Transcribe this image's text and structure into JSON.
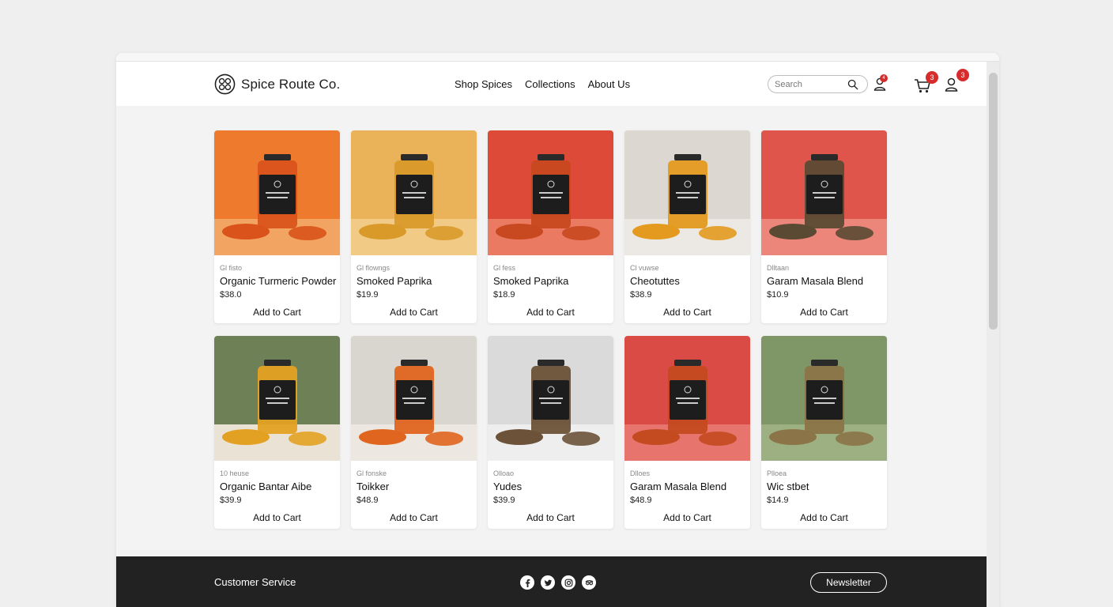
{
  "brand": {
    "name": "Spice Route Co."
  },
  "nav": [
    {
      "label": "Shop Spices"
    },
    {
      "label": "Collections"
    },
    {
      "label": "About Us"
    }
  ],
  "search": {
    "placeholder": "Search"
  },
  "header_icons": {
    "account_small_badge": "4",
    "cart_badge": "3",
    "user_badge": "3"
  },
  "colors": {
    "accent": "#d82b2b",
    "footer_bg": "#222222",
    "card_bg": "#ffffff"
  },
  "products": [
    {
      "category": "Gl fisto",
      "name": "Organic Turmeric Powder",
      "price": "$38.0",
      "button": "Add to Cart",
      "bg": "#ee7a2e",
      "bg2": "#f2a562",
      "powder": "#d9531b"
    },
    {
      "category": "Gl flowngs",
      "name": "Smoked Paprika",
      "price": "$19.9",
      "button": "Add to Cart",
      "bg": "#eab35a",
      "bg2": "#f1ca86",
      "powder": "#d99a2a"
    },
    {
      "category": "Gl fess",
      "name": "Smoked Paprika",
      "price": "$18.9",
      "button": "Add to Cart",
      "bg": "#de4a38",
      "bg2": "#ea7a61",
      "powder": "#c8481f"
    },
    {
      "category": "Cl vuwse",
      "name": "Cheotuttes",
      "price": "$38.9",
      "button": "Add to Cart",
      "bg": "#dcd8d1",
      "bg2": "#ece9e4",
      "powder": "#e39a1f"
    },
    {
      "category": "Dlltaan",
      "name": "Garam Masala Blend",
      "price": "$10.9",
      "button": "Add to Cart",
      "bg": "#e0554b",
      "bg2": "#ec867b",
      "powder": "#5b4a33"
    },
    {
      "category": "10 heuse",
      "name": "Organic Bantar Aibe",
      "price": "$39.9",
      "button": "Add to Cart",
      "bg": "#6e8056",
      "bg2": "#eae3d5",
      "powder": "#e3a123"
    },
    {
      "category": "Gl fonske",
      "name": "Toikker",
      "price": "$48.9",
      "button": "Add to Cart",
      "bg": "#d9d6d0",
      "bg2": "#ece8e1",
      "powder": "#e0651f"
    },
    {
      "category": "Olloao",
      "name": "Yudes",
      "price": "$39.9",
      "button": "Add to Cart",
      "bg": "#dadada",
      "bg2": "#eeeeee",
      "powder": "#6b5238"
    },
    {
      "category": "Dlloes",
      "name": "Garam Masala Blend",
      "price": "$48.9",
      "button": "Add to Cart",
      "bg": "#d94b44",
      "bg2": "#e8756d",
      "powder": "#c44a20"
    },
    {
      "category": "Plloea",
      "name": "Wic stbet",
      "price": "$14.9",
      "button": "Add to Cart",
      "bg": "#7f9766",
      "bg2": "#9db081",
      "powder": "#8b7448"
    }
  ],
  "footer": {
    "customer_service": "Customer Service",
    "socials": [
      "facebook-icon",
      "twitter-icon",
      "instagram-icon",
      "tripadvisor-icon"
    ],
    "newsletter": "Newsletter"
  }
}
